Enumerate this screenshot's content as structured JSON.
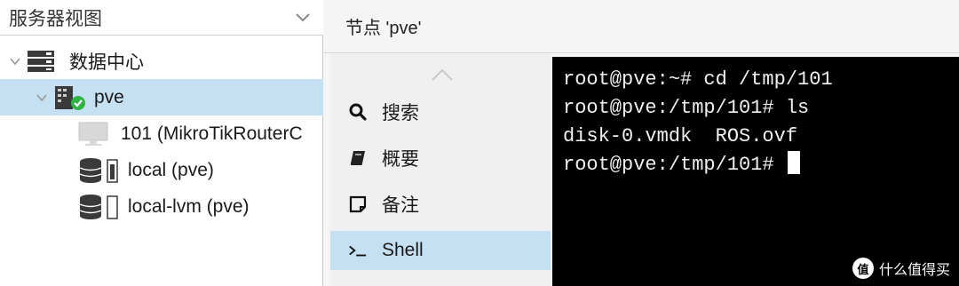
{
  "view_selector": {
    "value": "服务器视图",
    "icon": "chevron-down-icon"
  },
  "tree": {
    "datacenter": {
      "label": "数据中心",
      "icon": "server-rack-icon"
    },
    "node": {
      "label": "pve",
      "icon": "node-online-icon",
      "status_color": "#2fb344"
    },
    "vm": {
      "label": "101 (MikroTikRouterC",
      "icon": "monitor-icon"
    },
    "storage_local": {
      "label": "local (pve)",
      "icon": "storage-icon"
    },
    "storage_lvm": {
      "label": "local-lvm (pve)",
      "icon": "storage-icon"
    }
  },
  "header": {
    "title": "节点 'pve'"
  },
  "nav": {
    "items": [
      {
        "label": "搜索",
        "icon": "search-icon"
      },
      {
        "label": "概要",
        "icon": "book-icon"
      },
      {
        "label": "备注",
        "icon": "note-icon"
      },
      {
        "label": "Shell",
        "icon": "terminal-icon"
      }
    ],
    "active": "Shell"
  },
  "terminal": {
    "lines": [
      "root@pve:~# cd /tmp/101",
      "root@pve:/tmp/101# ls",
      "disk-0.vmdk  ROS.ovf",
      "root@pve:/tmp/101# "
    ]
  },
  "watermark": {
    "badge": "值",
    "text": "什么值得买"
  },
  "colors": {
    "selection": "#c5dff3",
    "terminal_bg": "#000000",
    "terminal_fg": "#f0f0f0"
  }
}
